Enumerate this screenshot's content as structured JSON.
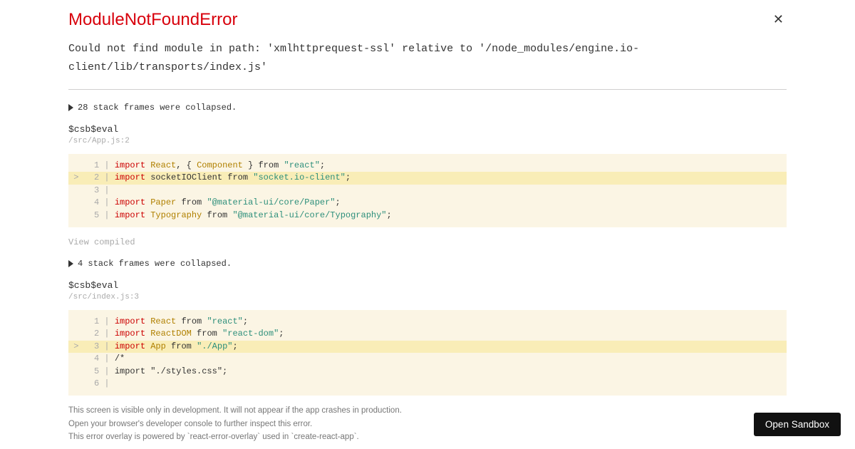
{
  "error": {
    "title": "ModuleNotFoundError",
    "message": "Could not find module in path: 'xmlhttprequest-ssl' relative to '/node_modules/engine.io-client/lib/transports/index.js'"
  },
  "collapse1": "28 stack frames were collapsed.",
  "collapse2": "4 stack frames were collapsed.",
  "frame1": {
    "title": "$csb$eval",
    "location": "/src/App.js:2",
    "lines": [
      {
        "n": "  1",
        "p": " ",
        "hl": false,
        "tokens": [
          {
            "t": "kw",
            "v": "import"
          },
          {
            "t": "plain",
            "v": " "
          },
          {
            "t": "class",
            "v": "React"
          },
          {
            "t": "punc",
            "v": ", { "
          },
          {
            "t": "class",
            "v": "Component"
          },
          {
            "t": "punc",
            "v": " } "
          },
          {
            "t": "plain",
            "v": "from "
          },
          {
            "t": "str",
            "v": "\"react\""
          },
          {
            "t": "punc",
            "v": ";"
          }
        ]
      },
      {
        "n": "  2",
        "p": ">",
        "hl": true,
        "tokens": [
          {
            "t": "kw",
            "v": "import"
          },
          {
            "t": "plain",
            "v": " socketIOClient from "
          },
          {
            "t": "str",
            "v": "\"socket.io-client\""
          },
          {
            "t": "punc",
            "v": ";"
          }
        ]
      },
      {
        "n": "  3",
        "p": " ",
        "hl": false,
        "tokens": []
      },
      {
        "n": "  4",
        "p": " ",
        "hl": false,
        "tokens": [
          {
            "t": "kw",
            "v": "import"
          },
          {
            "t": "plain",
            "v": " "
          },
          {
            "t": "class",
            "v": "Paper"
          },
          {
            "t": "plain",
            "v": " from "
          },
          {
            "t": "str",
            "v": "\"@material-ui/core/Paper\""
          },
          {
            "t": "punc",
            "v": ";"
          }
        ]
      },
      {
        "n": "  5",
        "p": " ",
        "hl": false,
        "tokens": [
          {
            "t": "kw",
            "v": "import"
          },
          {
            "t": "plain",
            "v": " "
          },
          {
            "t": "class",
            "v": "Typography"
          },
          {
            "t": "plain",
            "v": " from "
          },
          {
            "t": "str",
            "v": "\"@material-ui/core/Typography\""
          },
          {
            "t": "punc",
            "v": ";"
          }
        ]
      }
    ]
  },
  "frame2": {
    "title": "$csb$eval",
    "location": "/src/index.js:3",
    "lines": [
      {
        "n": "  1",
        "p": " ",
        "hl": false,
        "tokens": [
          {
            "t": "kw",
            "v": "import"
          },
          {
            "t": "plain",
            "v": " "
          },
          {
            "t": "class",
            "v": "React"
          },
          {
            "t": "plain",
            "v": " from "
          },
          {
            "t": "str",
            "v": "\"react\""
          },
          {
            "t": "punc",
            "v": ";"
          }
        ]
      },
      {
        "n": "  2",
        "p": " ",
        "hl": false,
        "tokens": [
          {
            "t": "kw",
            "v": "import"
          },
          {
            "t": "plain",
            "v": " "
          },
          {
            "t": "class",
            "v": "ReactDOM"
          },
          {
            "t": "plain",
            "v": " from "
          },
          {
            "t": "str",
            "v": "\"react-dom\""
          },
          {
            "t": "punc",
            "v": ";"
          }
        ]
      },
      {
        "n": "  3",
        "p": ">",
        "hl": true,
        "tokens": [
          {
            "t": "kw",
            "v": "import"
          },
          {
            "t": "plain",
            "v": " "
          },
          {
            "t": "class",
            "v": "App"
          },
          {
            "t": "plain",
            "v": " from "
          },
          {
            "t": "str",
            "v": "\"./App\""
          },
          {
            "t": "punc",
            "v": ";"
          }
        ]
      },
      {
        "n": "  4",
        "p": " ",
        "hl": false,
        "tokens": [
          {
            "t": "plain",
            "v": "/*"
          }
        ]
      },
      {
        "n": "  5",
        "p": " ",
        "hl": false,
        "tokens": [
          {
            "t": "plain",
            "v": "import \"./styles.css\";"
          }
        ]
      },
      {
        "n": "  6",
        "p": " ",
        "hl": false,
        "tokens": []
      }
    ]
  },
  "view_compiled": "View compiled",
  "footer": {
    "line1": "This screen is visible only in development. It will not appear if the app crashes in production.",
    "line2": "Open your browser's developer console to further inspect this error.",
    "line3": "This error overlay is powered by `react-error-overlay` used in `create-react-app`."
  },
  "open_sandbox": "Open Sandbox"
}
